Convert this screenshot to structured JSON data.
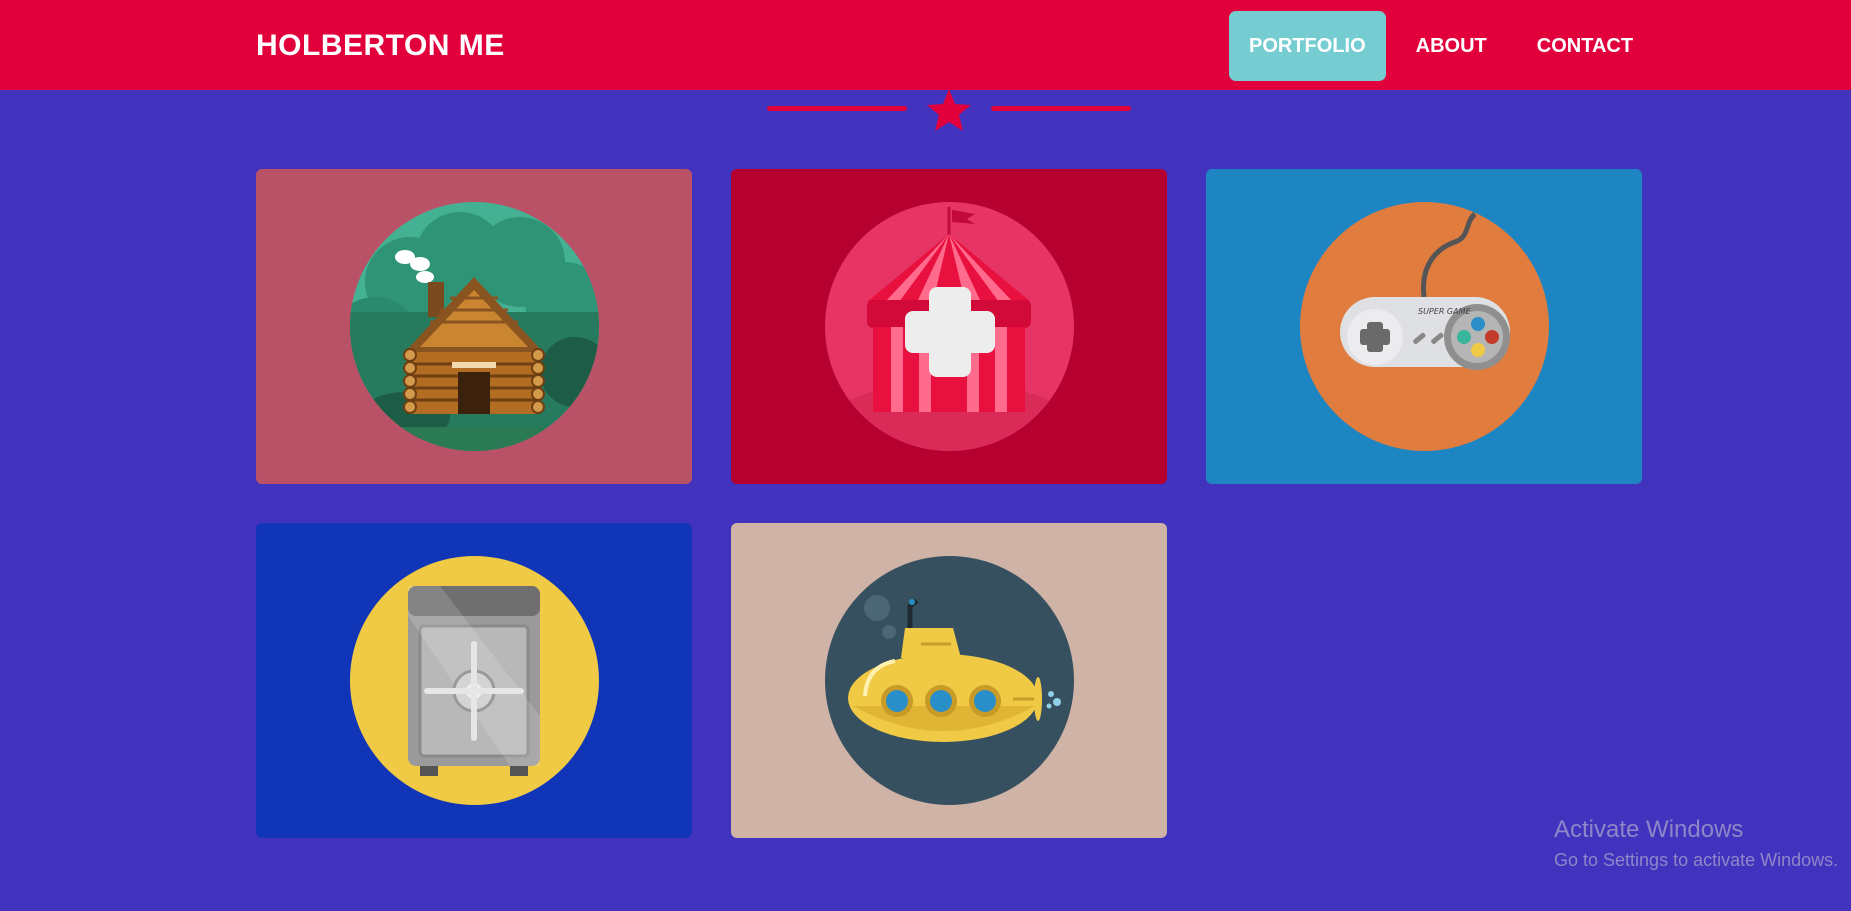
{
  "header": {
    "brand": "HOLBERTON ME",
    "nav": [
      {
        "label": "PORTFOLIO",
        "active": true
      },
      {
        "label": "ABOUT",
        "active": false
      },
      {
        "label": "CONTACT",
        "active": false
      }
    ]
  },
  "colors": {
    "page_background": "#4233be",
    "navbar": "#e1003c",
    "active_nav": "#76cdd1"
  },
  "portfolio": {
    "items": [
      {
        "icon": "log-cabin-icon",
        "card_color": "#b95267",
        "circle_color": "#44b292"
      },
      {
        "icon": "circus-tent-icon",
        "card_color": "#b50030",
        "circle_color": "#e63565"
      },
      {
        "icon": "game-controller-icon",
        "card_color": "#1e85c3",
        "circle_color": "#e07c3e"
      },
      {
        "icon": "safe-icon",
        "card_color": "#1035b6",
        "circle_color": "#f0c945"
      },
      {
        "icon": "submarine-icon",
        "card_color": "#ceb3a6",
        "circle_color": "#37505f"
      }
    ]
  },
  "watermark": {
    "title": "Activate Windows",
    "subtitle": "Go to Settings to activate Windows."
  }
}
